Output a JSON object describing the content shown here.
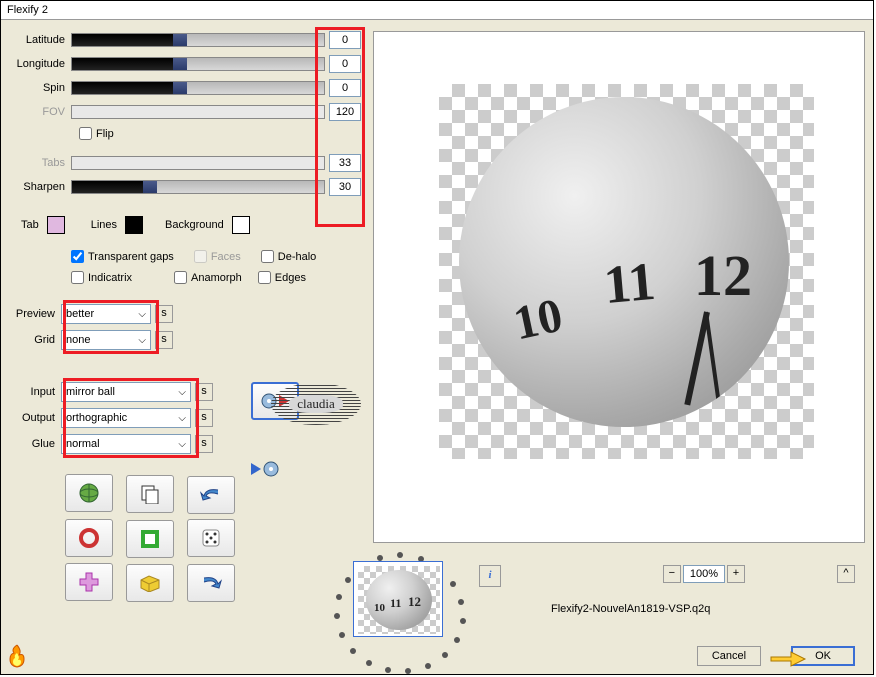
{
  "window": {
    "title": "Flexify 2"
  },
  "sliders": {
    "latitude": {
      "label": "Latitude",
      "value": "0",
      "pos": 40
    },
    "longitude": {
      "label": "Longitude",
      "value": "0",
      "pos": 40
    },
    "spin": {
      "label": "Spin",
      "value": "0",
      "pos": 40
    },
    "fov": {
      "label": "FOV",
      "value": "120",
      "disabled": true
    },
    "tabs": {
      "label": "Tabs",
      "value": "33",
      "disabled": true
    },
    "sharpen": {
      "label": "Sharpen",
      "value": "30",
      "pos": 28
    }
  },
  "flip": {
    "label": "Flip"
  },
  "colors": {
    "tab": {
      "label": "Tab",
      "color": "#e0b8e0"
    },
    "lines": {
      "label": "Lines",
      "color": "#000000"
    },
    "background": {
      "label": "Background",
      "color": "#ffffff"
    }
  },
  "checks": {
    "transparent_gaps": {
      "label": "Transparent gaps",
      "checked": true
    },
    "faces": {
      "label": "Faces",
      "checked": false,
      "disabled": true
    },
    "dehalo": {
      "label": "De-halo",
      "checked": false
    },
    "indicatrix": {
      "label": "Indicatrix",
      "checked": false
    },
    "anamorph": {
      "label": "Anamorph",
      "checked": false
    },
    "edges": {
      "label": "Edges",
      "checked": false
    }
  },
  "dropdowns": {
    "preview": {
      "label": "Preview",
      "value": "better"
    },
    "grid": {
      "label": "Grid",
      "value": "none"
    },
    "input": {
      "label": "Input",
      "value": "mirror ball"
    },
    "output": {
      "label": "Output",
      "value": "orthographic"
    },
    "glue": {
      "label": "Glue",
      "value": "normal"
    }
  },
  "watermark": "claudia",
  "bottom": {
    "zoom": "100%",
    "preset": "Flexify2-NouvelAn1819-VSP.q2q",
    "cancel": "Cancel",
    "ok": "OK"
  },
  "preview_clock": {
    "n10": "10",
    "n11": "11",
    "n12": "12"
  }
}
